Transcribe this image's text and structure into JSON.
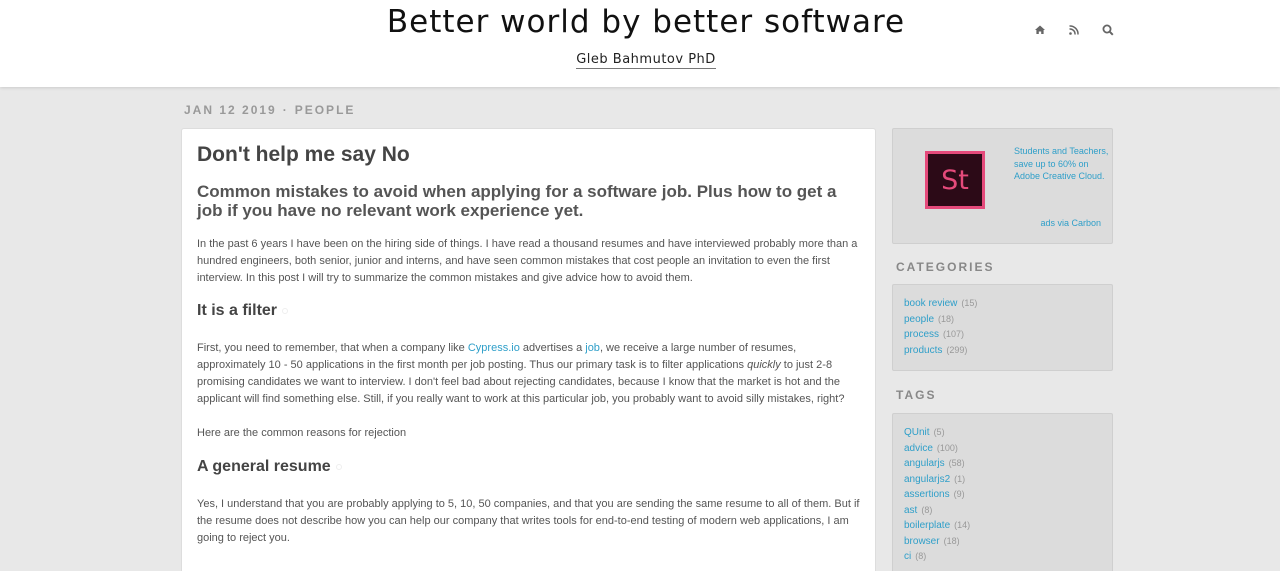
{
  "header": {
    "title": "Better world by better software",
    "author": "Gleb Bahmutov PhD",
    "icons": [
      "home-icon",
      "rss-icon",
      "search-icon"
    ]
  },
  "post": {
    "date": "JAN 12 2019",
    "separator": "·",
    "category": "PEOPLE",
    "title": "Don't help me say No",
    "subtitle": "Common mistakes to avoid when applying for a software job. Plus how to get a job if you have no relevant work experience yet.",
    "intro": "In the past 6 years I have been on the hiring side of things. I have read a thousand resumes and have interviewed probably more than a hundred engineers, both senior, junior and interns, and have seen common mistakes that cost people an invitation to even the first interview. In this post I will try to summarize the common mistakes and give advice how to avoid them.",
    "section1_heading": "It is a filter",
    "section1_p1_a": "First, you need to remember, that when a company like ",
    "section1_link1": "Cypress.io",
    "section1_p1_b": " advertises a ",
    "section1_link2": "job",
    "section1_p1_c": ", we receive a large number of resumes, approximately 10 - 50 applications in the first month per job posting. Thus our primary task is to filter applications ",
    "section1_p1_em": "quickly",
    "section1_p1_d": " to just 2-8 promising candidates we want to interview. I don't feel bad about rejecting candidates, because I know that the market is hot and the applicant will find something else. Still, if you really want to work at this particular job, you probably want to avoid silly mistakes, right?",
    "section1_p2": "Here are the common reasons for rejection",
    "section2_heading": "A general resume",
    "section2_p1": "Yes, I understand that you are probably applying to 5, 10, 50 companies, and that you are sending the same resume to all of them. But if the resume does not describe how you can help our company that writes tools for end-to-end testing of modern web applications, I am going to reject you."
  },
  "ad": {
    "logo_text": "St",
    "text": "Students and Teachers, save up to 60% on Adobe Creative Cloud.",
    "credit": "ads via Carbon"
  },
  "categories": {
    "heading": "CATEGORIES",
    "items": [
      {
        "label": "book review",
        "count": "(15)"
      },
      {
        "label": "people",
        "count": "(18)"
      },
      {
        "label": "process",
        "count": "(107)"
      },
      {
        "label": "products",
        "count": "(299)"
      }
    ]
  },
  "tags": {
    "heading": "TAGS",
    "items": [
      {
        "label": "QUnit",
        "count": "(5)"
      },
      {
        "label": "advice",
        "count": "(100)"
      },
      {
        "label": "angularjs",
        "count": "(58)"
      },
      {
        "label": "angularjs2",
        "count": "(1)"
      },
      {
        "label": "assertions",
        "count": "(9)"
      },
      {
        "label": "ast",
        "count": "(8)"
      },
      {
        "label": "boilerplate",
        "count": "(14)"
      },
      {
        "label": "browser",
        "count": "(18)"
      },
      {
        "label": "ci",
        "count": "(8)"
      }
    ]
  },
  "colors": {
    "link": "#2f9fc9",
    "background": "#e8e8e8",
    "sidebar_box": "#dcdcdc",
    "ad_accent": "#e54a7b"
  }
}
